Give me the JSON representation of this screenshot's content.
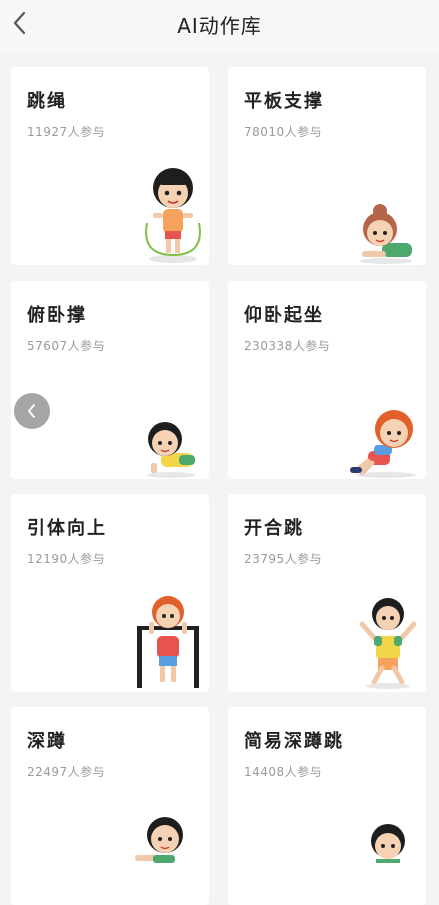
{
  "header": {
    "title": "AI动作库",
    "back_icon": "chevron-left-icon"
  },
  "cards": [
    {
      "name": "跳绳",
      "count": "11927人参与"
    },
    {
      "name": "平板支撑",
      "count": "78010人参与"
    },
    {
      "name": "俯卧撑",
      "count": "57607人参与"
    },
    {
      "name": "仰卧起坐",
      "count": "230338人参与"
    },
    {
      "name": "引体向上",
      "count": "12190人参与"
    },
    {
      "name": "开合跳",
      "count": "23795人参与"
    },
    {
      "name": "深蹲",
      "count": "22497人参与"
    },
    {
      "name": "简易深蹲跳",
      "count": "14408人参与"
    }
  ],
  "overlay": {
    "prev_icon": "chevron-left-icon"
  }
}
